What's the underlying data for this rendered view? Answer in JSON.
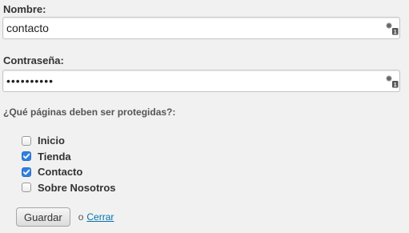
{
  "form": {
    "name_label": "Nombre:",
    "name_value": "contacto",
    "password_label": "Contraseña:",
    "password_value": "••••••••••",
    "question": "¿Qué páginas deben ser protegidas?:",
    "pages": [
      {
        "label": "Inicio",
        "checked": false
      },
      {
        "label": "Tienda",
        "checked": true
      },
      {
        "label": "Contacto",
        "checked": true
      },
      {
        "label": "Sobre Nosotros",
        "checked": false
      }
    ],
    "save_label": "Guardar",
    "or_text": "o",
    "close_label": "Cerrar"
  },
  "icons": {
    "field_icon": "key-badge-icon"
  },
  "colors": {
    "checkbox_checked": "#2f7fe0",
    "link": "#0073aa",
    "background": "#f1f1f1"
  }
}
